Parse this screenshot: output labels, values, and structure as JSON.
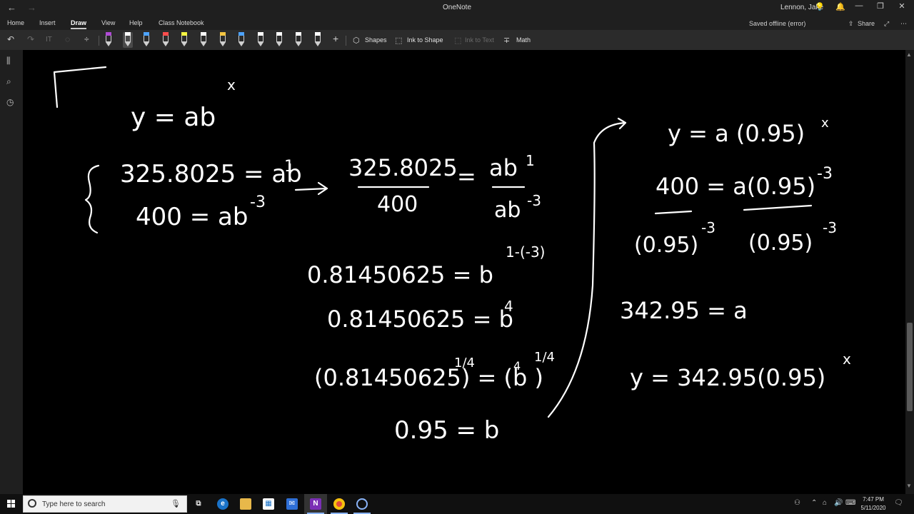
{
  "window": {
    "app_title": "OneNote",
    "user_name": "Lennon, Jake",
    "back_icon": "←",
    "forward_icon": "→"
  },
  "ribbon": {
    "tabs": [
      "Home",
      "Insert",
      "Draw",
      "View",
      "Help",
      "Class Notebook"
    ],
    "active_tab": "Draw",
    "status": "Saved offline (error)",
    "share_label": "Share"
  },
  "toolbar": {
    "shapes_label": "Shapes",
    "ink_to_shape_label": "Ink to Shape",
    "ink_to_text_label": "Ink to Text",
    "math_label": "Math",
    "pen_colors": [
      "#b04ad6",
      "#ffffff",
      "#4da3ff",
      "#ff4d4d",
      "#f5f542",
      "#ffffff",
      "#f5c542",
      "#4da3ff",
      "#ffffff",
      "#ffffff",
      "#ffffff",
      "#ffffff"
    ]
  },
  "page": {
    "ink": {
      "general_form": "y = ab^x",
      "system_eq1": "325.8025 = ab^1",
      "system_eq2": "400 = ab^-3",
      "division": "325.8025 / 400 = ab^1 / ab^-3",
      "step1": "0.81450625 = b^(1-(-3))",
      "step2": "0.81450625 = b^4",
      "step3": "(0.81450625)^(1/4) = (b^4)^(1/4)",
      "b_result": "0.95 = b",
      "sub1": "y = a(0.95)^x",
      "sub2": "400 = a(0.95)^-3",
      "sub3": "(0.95)^-3     (0.95)^-3",
      "a_result": "342.95 = a",
      "final": "y = 342.95(0.95)^x"
    }
  },
  "taskbar": {
    "search_placeholder": "Type here to search",
    "time": "7:47 PM",
    "date": "5/11/2020"
  },
  "colors": {
    "canvas": "#000000",
    "ink": "#ffffff",
    "chrome": "#1f1f1f",
    "toolbar": "#2b2b2b"
  }
}
